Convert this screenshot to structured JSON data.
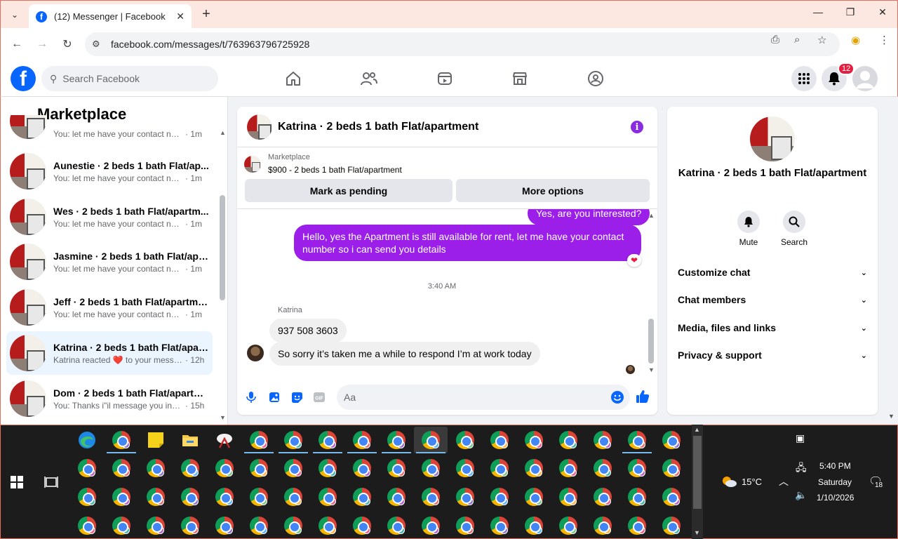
{
  "browser": {
    "tab_title": "(12) Messenger | Facebook",
    "tab_close": "✕",
    "new_tab": "+",
    "url": "facebook.com/messages/t/763963796725928",
    "win_min": "—",
    "win_max": "❐",
    "win_close": "✕"
  },
  "fb_header": {
    "search_placeholder": "Search Facebook",
    "notifications_count": "12"
  },
  "left_pane": {
    "title": "Marketplace",
    "conversations": [
      {
        "name": "",
        "preview": "You: let me have your contact nu...",
        "time": "· 1m"
      },
      {
        "name": "Aunestie · 2 beds 1 bath Flat/ap...",
        "preview": "You: let me have your contact nu...",
        "time": "· 1m"
      },
      {
        "name": "Wes · 2 beds 1 bath Flat/apartm...",
        "preview": "You: let me have your contact nu...",
        "time": "· 1m"
      },
      {
        "name": "Jasmine · 2 beds 1 bath Flat/apa...",
        "preview": "You: let me have your contact nu...",
        "time": "· 1m"
      },
      {
        "name": "Jeff · 2 beds 1 bath Flat/apartme...",
        "preview": "You: let me have your contact nu...",
        "time": "· 1m"
      },
      {
        "name": "Katrina · 2 beds 1 bath Flat/apar...",
        "preview": "Katrina reacted ❤️ to your messa...",
        "time": "· 12h"
      },
      {
        "name": "Dom · 2 beds 1 bath Flat/apartm...",
        "preview": "You: Thanks i\"il message you in a ...",
        "time": "· 15h"
      }
    ]
  },
  "chat": {
    "title": "Katrina · 2 beds 1 bath Flat/apartment",
    "marketplace_label": "Marketplace",
    "listing": "$900 - 2 beds 1 bath Flat/apartment",
    "mark_pending": "Mark as pending",
    "more_options": "More options",
    "msg_partial": "Yes, are you interested?",
    "msg_out": "Hello, yes the Apartment is still available for rent, let me have your contact number so i can send you details",
    "reaction": "❤",
    "timestamp": "3:40 AM",
    "sender": "Katrina",
    "msg_in_1": "937 508 3603",
    "msg_in_2": "So sorry it’s taken me a while to respond I’m at work today",
    "composer_placeholder": "Aa"
  },
  "right_pane": {
    "name": "Katrina · 2 beds 1 bath Flat/apartment",
    "mute": "Mute",
    "search": "Search",
    "rows": [
      "Customize chat",
      "Chat members",
      "Media, files and links",
      "Privacy & support"
    ]
  },
  "tray": {
    "weather": "15°C",
    "time": "5:40 PM",
    "day": "Saturday",
    "date": "1/10/2026",
    "notif_count": "18"
  },
  "colors": {
    "accent": "#9b1fe8",
    "fb_blue": "#0866ff",
    "badge_red": "#e41e3f"
  }
}
